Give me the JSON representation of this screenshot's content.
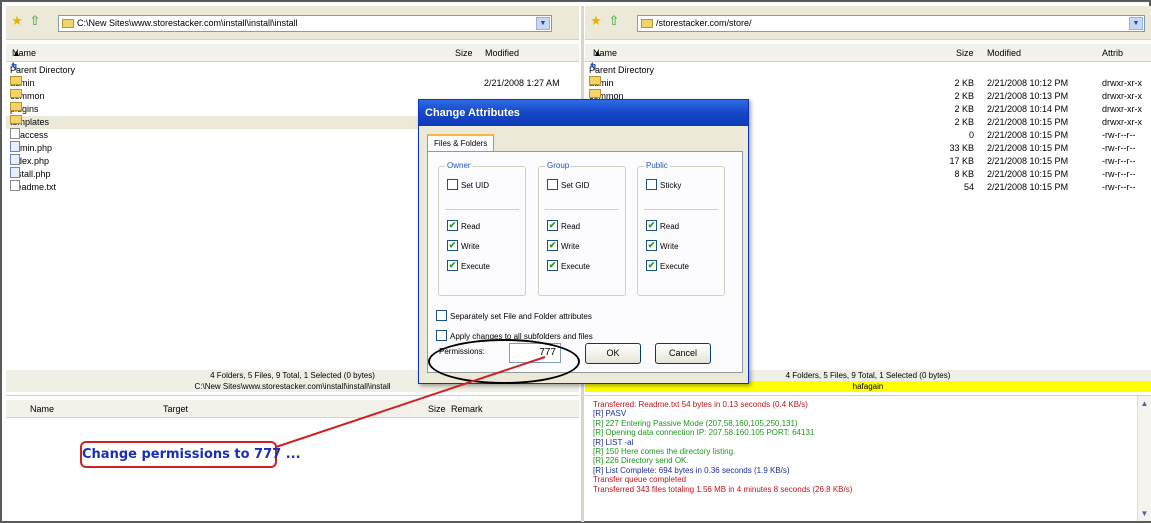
{
  "left": {
    "path": "C:\\New Sites\\www.storestacker.com\\install\\install\\install",
    "headers": {
      "name": "Name",
      "size": "Size",
      "modified": "Modified"
    },
    "rows": [
      {
        "name": "Parent Directory",
        "type": "up",
        "modified": ""
      },
      {
        "name": "admin",
        "type": "folder",
        "modified": "2/21/2008 1:27 AM"
      },
      {
        "name": "common",
        "type": "folder",
        "modified": ""
      },
      {
        "name": "plugins",
        "type": "folder",
        "modified": ""
      },
      {
        "name": "templates",
        "type": "folder",
        "modified": ""
      },
      {
        "name": ".htaccess",
        "type": "file",
        "modified": ""
      },
      {
        "name": "admin.php",
        "type": "php",
        "modified": ""
      },
      {
        "name": "index.php",
        "type": "php",
        "modified": ""
      },
      {
        "name": "install.php",
        "type": "php",
        "modified": ""
      },
      {
        "name": "Readme.txt",
        "type": "file",
        "modified": ""
      }
    ],
    "status1": "4 Folders, 5 Files, 9 Total, 1 Selected (0 bytes)",
    "status2": "C:\\New Sites\\www.storestacker.com\\install\\install\\install"
  },
  "right": {
    "path": "/storestacker.com/store/",
    "headers": {
      "name": "Name",
      "size": "Size",
      "modified": "Modified",
      "attrib": "Attrib"
    },
    "rows": [
      {
        "name": "Parent Directory",
        "type": "up",
        "size": "",
        "modified": "",
        "attrib": ""
      },
      {
        "name": "admin",
        "type": "folder",
        "size": "2 KB",
        "modified": "2/21/2008 10:12 PM",
        "attrib": "drwxr-xr-x"
      },
      {
        "name": "common",
        "type": "folder",
        "size": "2 KB",
        "modified": "2/21/2008 10:13 PM",
        "attrib": "drwxr-xr-x"
      },
      {
        "name": "",
        "type": "none",
        "size": "2 KB",
        "modified": "2/21/2008 10:14 PM",
        "attrib": "drwxr-xr-x"
      },
      {
        "name": "",
        "type": "none",
        "size": "2 KB",
        "modified": "2/21/2008 10:15 PM",
        "attrib": "drwxr-xr-x"
      },
      {
        "name": "",
        "type": "none",
        "size": "0",
        "modified": "2/21/2008 10:15 PM",
        "attrib": "-rw-r--r--"
      },
      {
        "name": "",
        "type": "none",
        "size": "33 KB",
        "modified": "2/21/2008 10:15 PM",
        "attrib": "-rw-r--r--"
      },
      {
        "name": "",
        "type": "none",
        "size": "17 KB",
        "modified": "2/21/2008 10:15 PM",
        "attrib": "-rw-r--r--"
      },
      {
        "name": "",
        "type": "none",
        "size": "8 KB",
        "modified": "2/21/2008 10:15 PM",
        "attrib": "-rw-r--r--"
      },
      {
        "name": "",
        "type": "none",
        "size": "54",
        "modified": "2/21/2008 10:15 PM",
        "attrib": "-rw-r--r--"
      }
    ],
    "status1": "4 Folders, 5 Files, 9 Total, 1 Selected (0 bytes)",
    "status2": "hafagain"
  },
  "queue": {
    "headers": {
      "name": "Name",
      "target": "Target",
      "size": "Size",
      "remark": "Remark"
    }
  },
  "log": [
    {
      "text": "Transferred: Readme.txt 54 bytes in 0.13 seconds (0.4 KB/s)",
      "color": "#c0161d"
    },
    {
      "text": "[R] PASV",
      "color": "#1c2ea0"
    },
    {
      "text": "[R] 227 Entering Passive Mode (207,58,160,105,250,131)",
      "color": "#1c9a1c"
    },
    {
      "text": "[R] Opening data connection IP: 207.58.160.105 PORT: 64131",
      "color": "#1c9a1c"
    },
    {
      "text": "[R] LIST -al",
      "color": "#1c2ea0"
    },
    {
      "text": "[R] 150 Here comes the directory listing.",
      "color": "#1c9a1c"
    },
    {
      "text": "[R] 226 Directory send OK.",
      "color": "#1c9a1c"
    },
    {
      "text": "[R] List Complete: 694 bytes in 0.36 seconds (1.9 KB/s)",
      "color": "#1c2ea0"
    },
    {
      "text": "Transfer queue completed",
      "color": "#c0161d"
    },
    {
      "text": "Transferred 343 files totaling 1.56 MB in 4 minutes 8 seconds (26.8 KB/s)",
      "color": "#c0161d"
    }
  ],
  "dialog": {
    "title": "Change Attributes",
    "tab": "Files & Folders",
    "owner": {
      "label": "Owner",
      "special": "Set UID",
      "special_checked": false,
      "read": true,
      "write": true,
      "execute": true
    },
    "group": {
      "label": "Group",
      "special": "Set GID",
      "special_checked": false,
      "read": true,
      "write": true,
      "execute": true
    },
    "public": {
      "label": "Public",
      "special": "Sticky",
      "special_checked": false,
      "read": true,
      "write": true,
      "execute": true
    },
    "read_label": "Read",
    "write_label": "Write",
    "execute_label": "Execute",
    "opt_separate": "Separately set File and Folder attributes",
    "opt_recursive": "Apply changes to all subfolders and files",
    "permissions_label": "Permissions:",
    "permissions_value": "777",
    "ok": "OK",
    "cancel": "Cancel"
  },
  "annotation": {
    "text": "Change permissions to 777 ...",
    "box_border": "#cc2222",
    "text_color": "#1a2fb8"
  }
}
